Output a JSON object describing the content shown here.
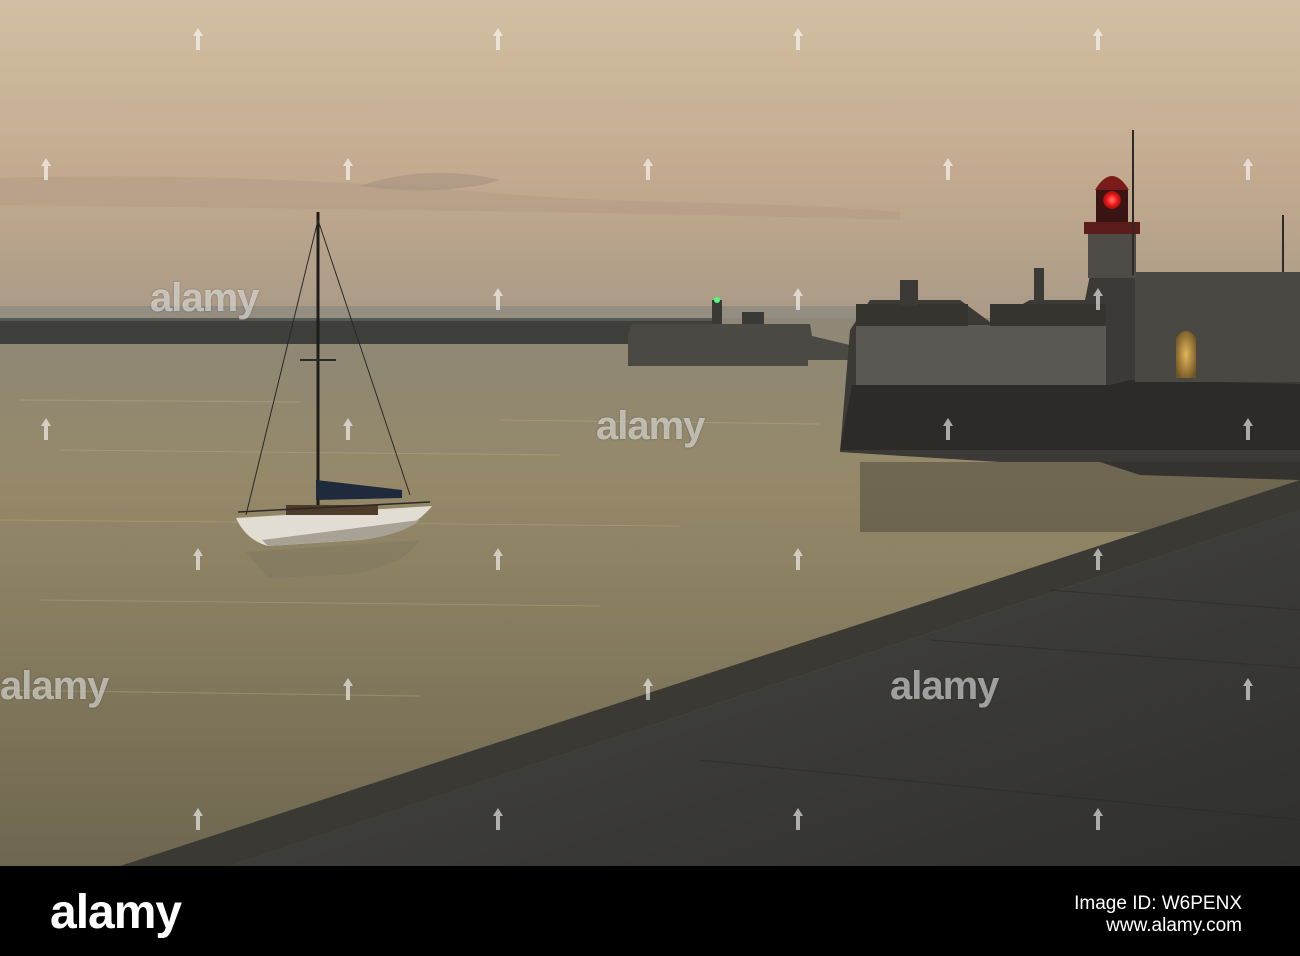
{
  "photo": {
    "subject": "",
    "colors": {
      "sky_top": "#c9b497",
      "sky_horizon": "#b99d84",
      "water": "#8d8163",
      "quay": "#3a3a36",
      "lighthouse_lamp": "#ff1e1e",
      "green_light": "#4dff7a"
    }
  },
  "watermark": {
    "text": "alamy"
  },
  "footer": {
    "logo": "alamy",
    "credit_line1": "Image ID: W6PENX",
    "credit_line2": "www.alamy.com"
  }
}
